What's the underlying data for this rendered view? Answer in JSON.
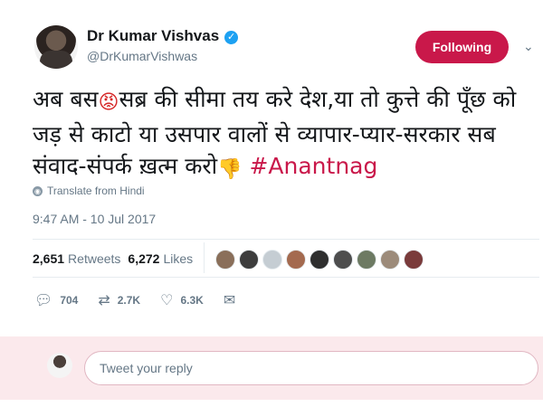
{
  "author": {
    "name": "Dr Kumar Vishvas",
    "handle": "@DrKumarVishwas",
    "verified_mark": "✓"
  },
  "follow_button": {
    "label": "Following",
    "color": "#c9184a"
  },
  "menu_chevron": "⌄",
  "tweet": {
    "text_part1": "अब बस",
    "text_part2": "सब्र की सीमा तय करे देश,या तो कुत्ते की पूँछ को जड़ से काटो या उसपार वालों से व्यापार-प्यार-सरकार सब संवाद-संपर्क ख़त्म करो",
    "hashtag": "#Anantnag",
    "emoji_angry": "😡",
    "emoji_thumb": "👎"
  },
  "translate": {
    "label": "Translate from Hindi",
    "icon": "globe-icon"
  },
  "timestamp": "9:47 AM - 10 Jul 2017",
  "stats": {
    "retweets_count": "2,651",
    "retweets_label": "Retweets",
    "likes_count": "6,272",
    "likes_label": "Likes"
  },
  "likers": [
    "#8a6f5a",
    "#3d3d3d",
    "#c5cdd3",
    "#a46a4f",
    "#2f2f2f",
    "#4e4e4e",
    "#6d7a63",
    "#9c8b7a",
    "#7a3b3b"
  ],
  "actions": {
    "reply_count": "704",
    "retweet_count": "2.7K",
    "like_count": "6.3K"
  },
  "reply_box": {
    "placeholder": "Tweet your reply"
  }
}
